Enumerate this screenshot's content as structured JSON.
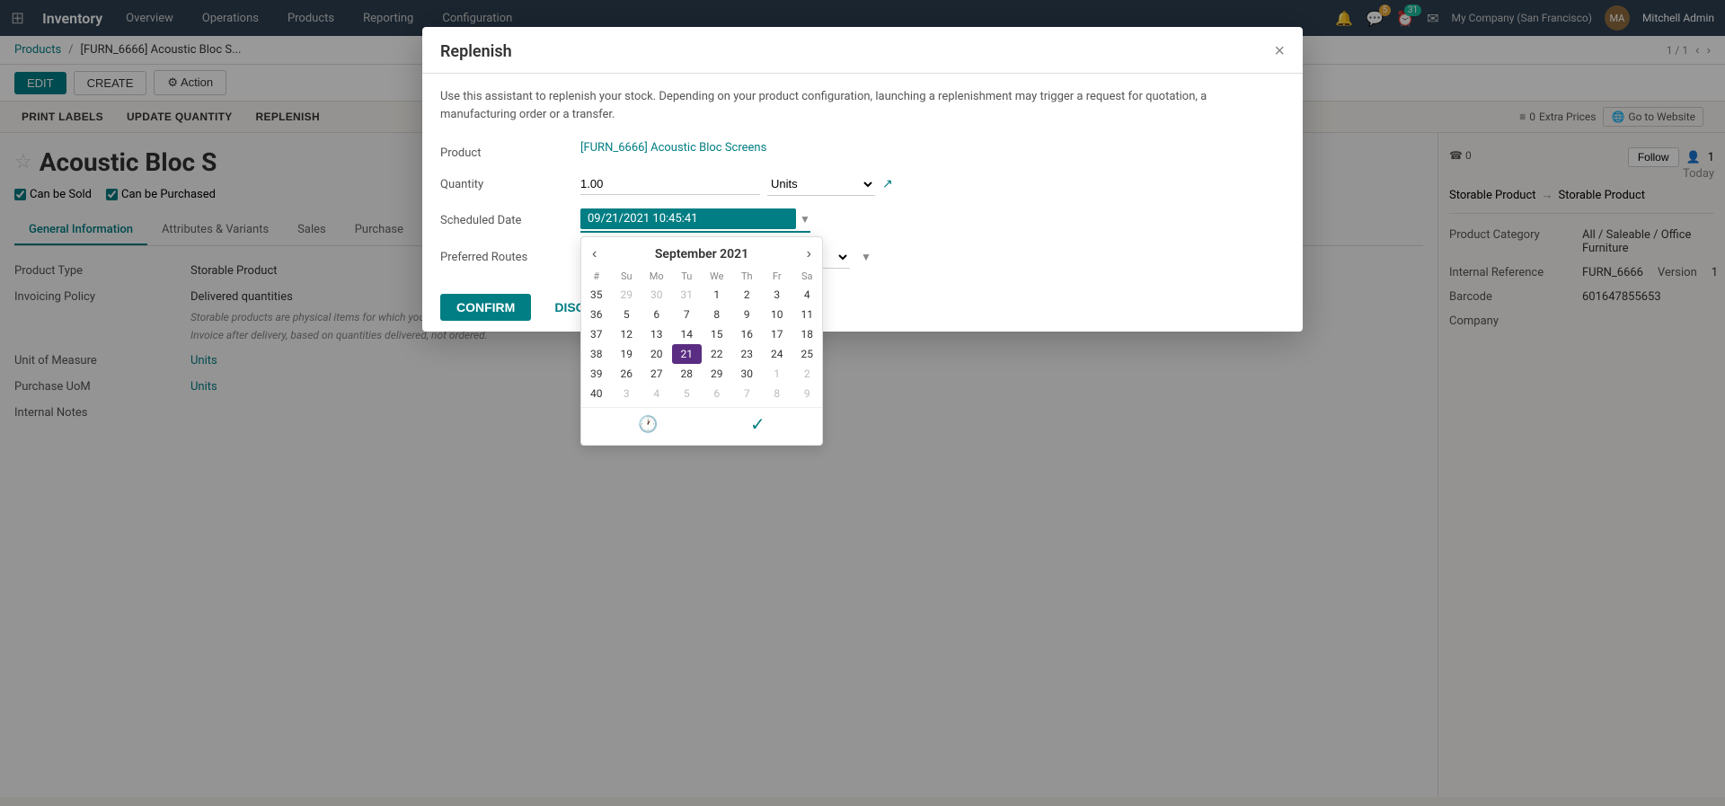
{
  "app": {
    "name": "Inventory",
    "grid_icon": "⊞"
  },
  "top_nav": {
    "items": [
      "Overview",
      "Operations",
      "Products",
      "Reporting",
      "Configuration"
    ],
    "notifications": [
      {
        "icon": "🔔",
        "count": null
      },
      {
        "icon": "💬",
        "count": "5",
        "badge_color": "#e8a838"
      },
      {
        "icon": "⏰",
        "count": "31",
        "badge_color": "#1abc9c"
      },
      {
        "icon": "✉",
        "count": null
      }
    ],
    "company": "My Company (San Francisco)",
    "user": "Mitchell Admin"
  },
  "breadcrumb": {
    "parent": "Products",
    "current": "[FURN_6666] Acoustic Bloc S...",
    "pagination": "1 / 1"
  },
  "action_bar": {
    "edit_label": "EDIT",
    "create_label": "CREATE",
    "action_label": "⚙ Action"
  },
  "sub_toolbar": {
    "buttons": [
      "PRINT LABELS",
      "UPDATE QUANTITY",
      "REPLENISH"
    ]
  },
  "right_panel": {
    "today_label": "Today",
    "follow_label": "Follow",
    "followers_count": "1",
    "activity_count": "0",
    "product_type_from": "Storable Product",
    "product_type_to": "Storable Product"
  },
  "product": {
    "name": "Acoustic Bloc S",
    "can_be_sold": true,
    "can_be_purchased": true,
    "tabs": [
      "General Information",
      "Attributes & Variants",
      "Sales",
      "Purchase"
    ],
    "active_tab": "General Information",
    "product_type_label": "Product Type",
    "product_type_value": "Storable Product",
    "invoicing_policy_label": "Invoicing Policy",
    "invoicing_policy_value": "Delivered quantities",
    "invoicing_note1": "Storable products are physical items for which you manage the inventory level.",
    "invoicing_note2": "Invoice after delivery, based on quantities delivered, not ordered.",
    "uom_label": "Unit of Measure",
    "uom_value": "Units",
    "purchase_uom_label": "Purchase UoM",
    "purchase_uom_value": "Units",
    "internal_notes_label": "Internal Notes",
    "extra_prices_count": "0",
    "extra_prices_label": "Extra Prices",
    "go_to_website_label": "Go to Website",
    "product_category_label": "Product Category",
    "product_category_value": "All / Saleable / Office Furniture",
    "internal_ref_label": "Internal Reference",
    "internal_ref_value": "FURN_6666",
    "version_label": "Version",
    "version_value": "1",
    "barcode_label": "Barcode",
    "barcode_value": "601647855653",
    "company_label": "Company"
  },
  "modal": {
    "title": "Replenish",
    "close_icon": "×",
    "description": "Use this assistant to replenish your stock. Depending on your product configuration, launching a replenishment may trigger a request for quotation, a manufacturing order or a transfer.",
    "product_label": "Product",
    "product_value": "[FURN_6666] Acoustic Bloc Screens",
    "quantity_label": "Quantity",
    "quantity_value": "1.00",
    "units_value": "Units",
    "scheduled_date_label": "Scheduled Date",
    "scheduled_date_value": "09/21/2021 10:45:41",
    "preferred_routes_label": "Preferred Routes",
    "confirm_label": "CONFIRM",
    "discard_label": "DISCARD"
  },
  "calendar": {
    "month_year": "September 2021",
    "day_headers": [
      "#",
      "Su",
      "Mo",
      "Tu",
      "We",
      "Th",
      "Fr",
      "Sa"
    ],
    "weeks": [
      {
        "week": "35",
        "days": [
          {
            "day": "29",
            "other": true
          },
          {
            "day": "30",
            "other": true
          },
          {
            "day": "31",
            "other": true
          },
          {
            "day": "1"
          },
          {
            "day": "2"
          },
          {
            "day": "3"
          },
          {
            "day": "4"
          }
        ]
      },
      {
        "week": "36",
        "days": [
          {
            "day": "5"
          },
          {
            "day": "6"
          },
          {
            "day": "7"
          },
          {
            "day": "8"
          },
          {
            "day": "9"
          },
          {
            "day": "10"
          },
          {
            "day": "11"
          }
        ]
      },
      {
        "week": "37",
        "days": [
          {
            "day": "12"
          },
          {
            "day": "13"
          },
          {
            "day": "14"
          },
          {
            "day": "15"
          },
          {
            "day": "16"
          },
          {
            "day": "17"
          },
          {
            "day": "18"
          }
        ]
      },
      {
        "week": "38",
        "days": [
          {
            "day": "19"
          },
          {
            "day": "20"
          },
          {
            "day": "21",
            "selected": true
          },
          {
            "day": "22"
          },
          {
            "day": "23"
          },
          {
            "day": "24"
          },
          {
            "day": "25"
          }
        ]
      },
      {
        "week": "39",
        "days": [
          {
            "day": "26"
          },
          {
            "day": "27"
          },
          {
            "day": "28"
          },
          {
            "day": "29"
          },
          {
            "day": "30"
          },
          {
            "day": "1",
            "other": true
          },
          {
            "day": "2",
            "other": true
          }
        ]
      },
      {
        "week": "40",
        "days": [
          {
            "day": "3",
            "other": true
          },
          {
            "day": "4",
            "other": true
          },
          {
            "day": "5",
            "other": true
          },
          {
            "day": "6",
            "other": true
          },
          {
            "day": "7",
            "other": true
          },
          {
            "day": "8",
            "other": true
          },
          {
            "day": "9",
            "other": true
          }
        ]
      }
    ]
  }
}
